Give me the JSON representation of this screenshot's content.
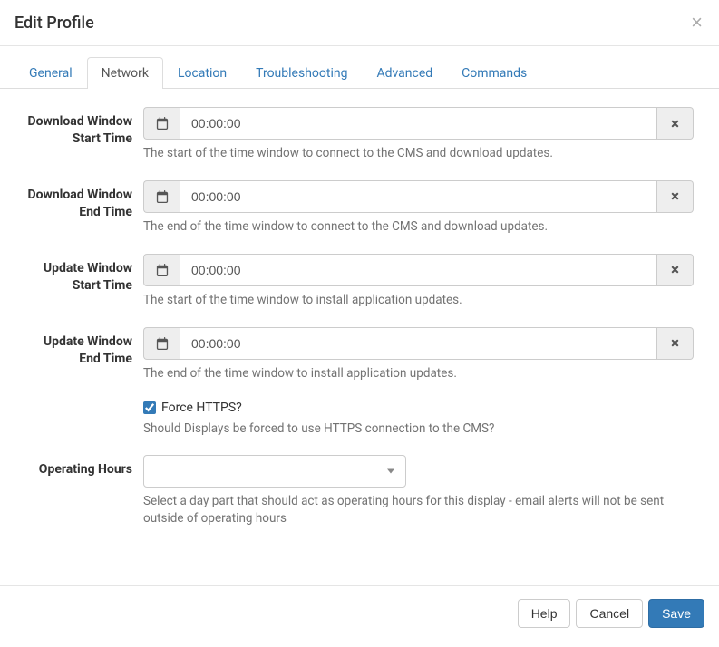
{
  "modal": {
    "title": "Edit Profile"
  },
  "tabs": {
    "general": "General",
    "network": "Network",
    "location": "Location",
    "troubleshooting": "Troubleshooting",
    "advanced": "Advanced",
    "commands": "Commands"
  },
  "fields": {
    "downloadStart": {
      "label": "Download Window Start Time",
      "value": "00:00:00",
      "help": "The start of the time window to connect to the CMS and download updates."
    },
    "downloadEnd": {
      "label": "Download Window End Time",
      "value": "00:00:00",
      "help": "The end of the time window to connect to the CMS and download updates."
    },
    "updateStart": {
      "label": "Update Window Start Time",
      "value": "00:00:00",
      "help": "The start of the time window to install application updates."
    },
    "updateEnd": {
      "label": "Update Window End Time",
      "value": "00:00:00",
      "help": "The end of the time window to install application updates."
    },
    "forceHttps": {
      "label": "Force HTTPS?",
      "help": "Should Displays be forced to use HTTPS connection to the CMS?"
    },
    "operatingHours": {
      "label": "Operating Hours",
      "value": "",
      "help": "Select a day part that should act as operating hours for this display - email alerts will not be sent outside of operating hours"
    }
  },
  "footer": {
    "help": "Help",
    "cancel": "Cancel",
    "save": "Save"
  }
}
